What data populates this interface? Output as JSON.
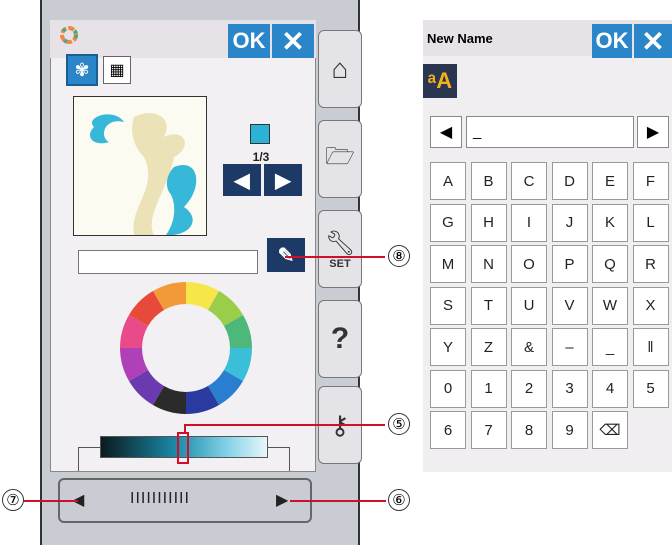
{
  "left_panel": {
    "ok_label": "OK",
    "pattern_counter": "1/3",
    "side_set_label": "SET",
    "side_help_label": "?",
    "nav_ticks": "IIIIIIIIIII"
  },
  "callouts": {
    "c8": "⑧",
    "c5": "⑤",
    "c7": "⑦",
    "c6": "⑥"
  },
  "keyboard": {
    "title": "New Name",
    "ok_label": "OK",
    "input_value": "_",
    "rows": [
      [
        "A",
        "B",
        "C",
        "D",
        "E",
        "F"
      ],
      [
        "G",
        "H",
        "I",
        "J",
        "K",
        "L"
      ],
      [
        "M",
        "N",
        "O",
        "P",
        "Q",
        "R"
      ],
      [
        "S",
        "T",
        "U",
        "V",
        "W",
        "X"
      ],
      [
        "Y",
        "Z",
        "&",
        "–",
        "_",
        "‖"
      ],
      [
        "0",
        "1",
        "2",
        "3",
        "4",
        "5"
      ],
      [
        "6",
        "7",
        "8",
        "9",
        "⌫",
        ""
      ]
    ]
  },
  "colors": {
    "accent_blue": "#2a86c8",
    "callout_red": "#d0102a",
    "swatch_cyan": "#2ab2d8"
  }
}
